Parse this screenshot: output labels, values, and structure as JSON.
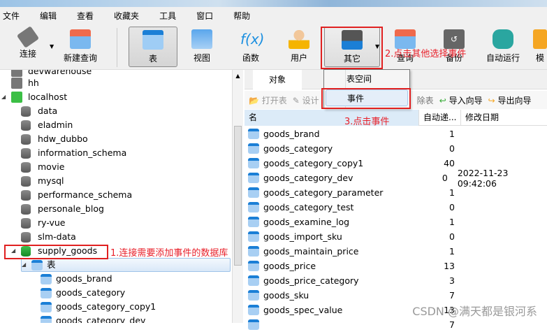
{
  "menu": [
    "文件",
    "编辑",
    "查看",
    "收藏夹",
    "工具",
    "窗口",
    "帮助"
  ],
  "toolbar": {
    "connect": "连接",
    "new_query": "新建查询",
    "table": "表",
    "view": "视图",
    "function": "函数",
    "user": "用户",
    "other": "其它",
    "query": "查询",
    "backup": "备份",
    "auto_run": "自动运行",
    "model": "模"
  },
  "dropdown": {
    "items": [
      "表空间",
      "事件"
    ]
  },
  "tree": {
    "connections": [
      "devwarehouse",
      "hh",
      "localhost"
    ],
    "databases": [
      "data",
      "eladmin",
      "hdw_dubbo",
      "information_schema",
      "movie",
      "mysql",
      "performance_schema",
      "personale_blog",
      "ry-vue",
      "slm-data",
      "supply_goods"
    ],
    "tables_node": "表",
    "tables": [
      "goods_brand",
      "goods_category",
      "goods_category_copy1",
      "goods_category_dev"
    ]
  },
  "objects_tab": "对象",
  "objbar": {
    "open": "打开表",
    "design": "设计",
    "delete": "除表",
    "import": "导入向导",
    "export": "导出向导"
  },
  "columns": [
    "名",
    "自动递...",
    "修改日期"
  ],
  "rows": [
    {
      "name": "goods_brand",
      "ai": "1",
      "date": ""
    },
    {
      "name": "goods_category",
      "ai": "0",
      "date": ""
    },
    {
      "name": "goods_category_copy1",
      "ai": "40",
      "date": ""
    },
    {
      "name": "goods_category_dev",
      "ai": "0",
      "date": "2022-11-23 09:42:06"
    },
    {
      "name": "goods_category_parameter",
      "ai": "1",
      "date": ""
    },
    {
      "name": "goods_category_test",
      "ai": "0",
      "date": ""
    },
    {
      "name": "goods_examine_log",
      "ai": "1",
      "date": ""
    },
    {
      "name": "goods_import_sku",
      "ai": "0",
      "date": ""
    },
    {
      "name": "goods_maintain_price",
      "ai": "1",
      "date": ""
    },
    {
      "name": "goods_price",
      "ai": "13",
      "date": ""
    },
    {
      "name": "goods_price_category",
      "ai": "3",
      "date": ""
    },
    {
      "name": "goods_sku",
      "ai": "7",
      "date": ""
    },
    {
      "name": "goods_spec_value",
      "ai": "13",
      "date": ""
    },
    {
      "name": "",
      "ai": "7",
      "date": ""
    }
  ],
  "annotations": {
    "step1": "1.连接需要添加事件的数据库",
    "step2": "2.点击其他选择事件",
    "step3": "3.点击事件"
  },
  "watermark": "CSDN @满天都是银河系",
  "colors": {
    "annotation": "#e02020",
    "accent": "#1b7fd6"
  }
}
